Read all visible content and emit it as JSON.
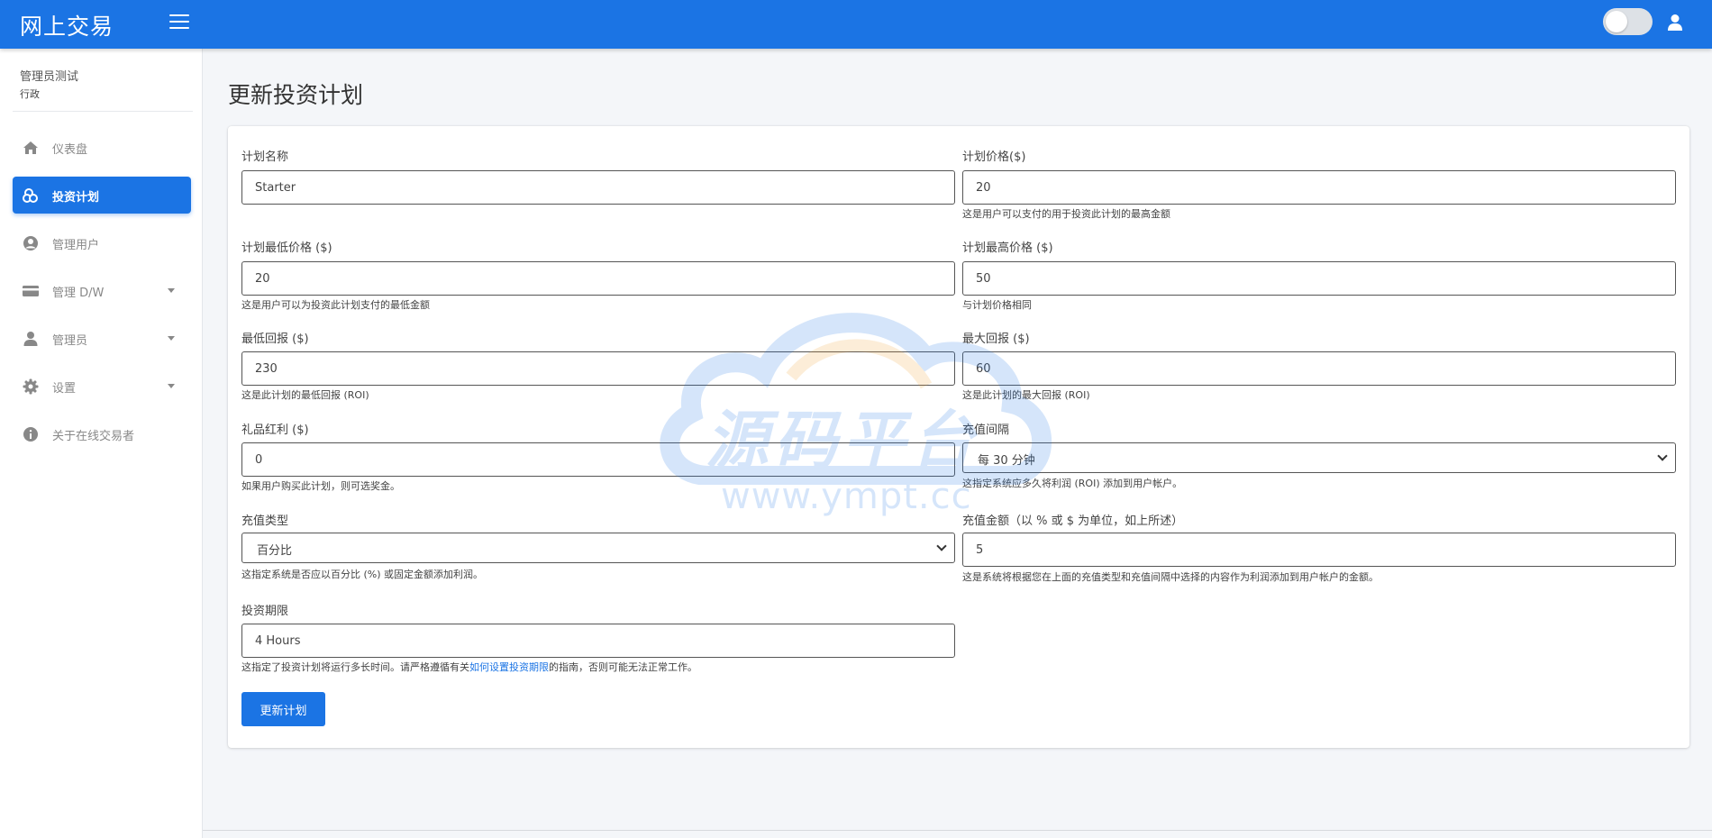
{
  "app": {
    "brand": "网上交易"
  },
  "header": {
    "menu_icon": "hamburger-icon",
    "user_icon": "user-icon",
    "theme_toggle": "off"
  },
  "sidebar": {
    "user_name": "管理员测试",
    "user_role": "行政",
    "items": [
      {
        "label": "仪表盘",
        "icon": "home-icon"
      },
      {
        "label": "投资计划",
        "icon": "coins-icon",
        "active": true
      },
      {
        "label": "管理用户",
        "icon": "user-circle-icon"
      },
      {
        "label": "管理 D/W",
        "icon": "credit-card-icon",
        "has_dropdown": true
      },
      {
        "label": "管理员",
        "icon": "user-icon",
        "has_dropdown": true
      },
      {
        "label": "设置",
        "icon": "gear-icon",
        "has_dropdown": true
      },
      {
        "label": "关于在线交易者",
        "icon": "info-icon"
      }
    ]
  },
  "page": {
    "title": "更新投资计划"
  },
  "form": {
    "plan_name": {
      "label": "计划名称",
      "value": "Starter"
    },
    "plan_price": {
      "label": "计划价格($)",
      "value": "20",
      "help": "这是用户可以支付的用于投资此计划的最高金额"
    },
    "min_price": {
      "label": "计划最低价格 ($)",
      "value": "20",
      "help": "这是用户可以为投资此计划支付的最低金额"
    },
    "max_price": {
      "label": "计划最高价格 ($)",
      "value": "50",
      "help": "与计划价格相同"
    },
    "min_return": {
      "label": "最低回报 ($)",
      "value": "230",
      "help": "这是此计划的最低回报 (ROI)"
    },
    "max_return": {
      "label": "最大回报 ($)",
      "value": "60",
      "help": "这是此计划的最大回报 (ROI)"
    },
    "gift_bonus": {
      "label": "礼品红利 ($)",
      "value": "0",
      "help": "如果用户购买此计划，则可选奖金。"
    },
    "topup_interval": {
      "label": "充值间隔",
      "value": "每 30 分钟",
      "help": "这指定系统应多久将利润 (ROI) 添加到用户帐户。"
    },
    "topup_type": {
      "label": "充值类型",
      "value": "百分比",
      "help": "这指定系统是否应以百分比 (%) 或固定金额添加利润。"
    },
    "topup_amount": {
      "label": "充值金额（以 % 或 $ 为单位，如上所述）",
      "value": "5",
      "help": "这是系统将根据您在上面的充值类型和充值间隔中选择的内容作为利润添加到用户帐户的金额。"
    },
    "duration": {
      "label": "投资期限",
      "value": "4 Hours",
      "help_before": "这指定了投资计划将运行多长时间。请严格遵循有关",
      "help_link": "如何设置投资期限",
      "help_after": "的指南，否则可能无法正常工作。"
    },
    "submit_label": "更新计划"
  },
  "watermark": {
    "title": "源码平台",
    "url": "www.ympt.cc"
  }
}
